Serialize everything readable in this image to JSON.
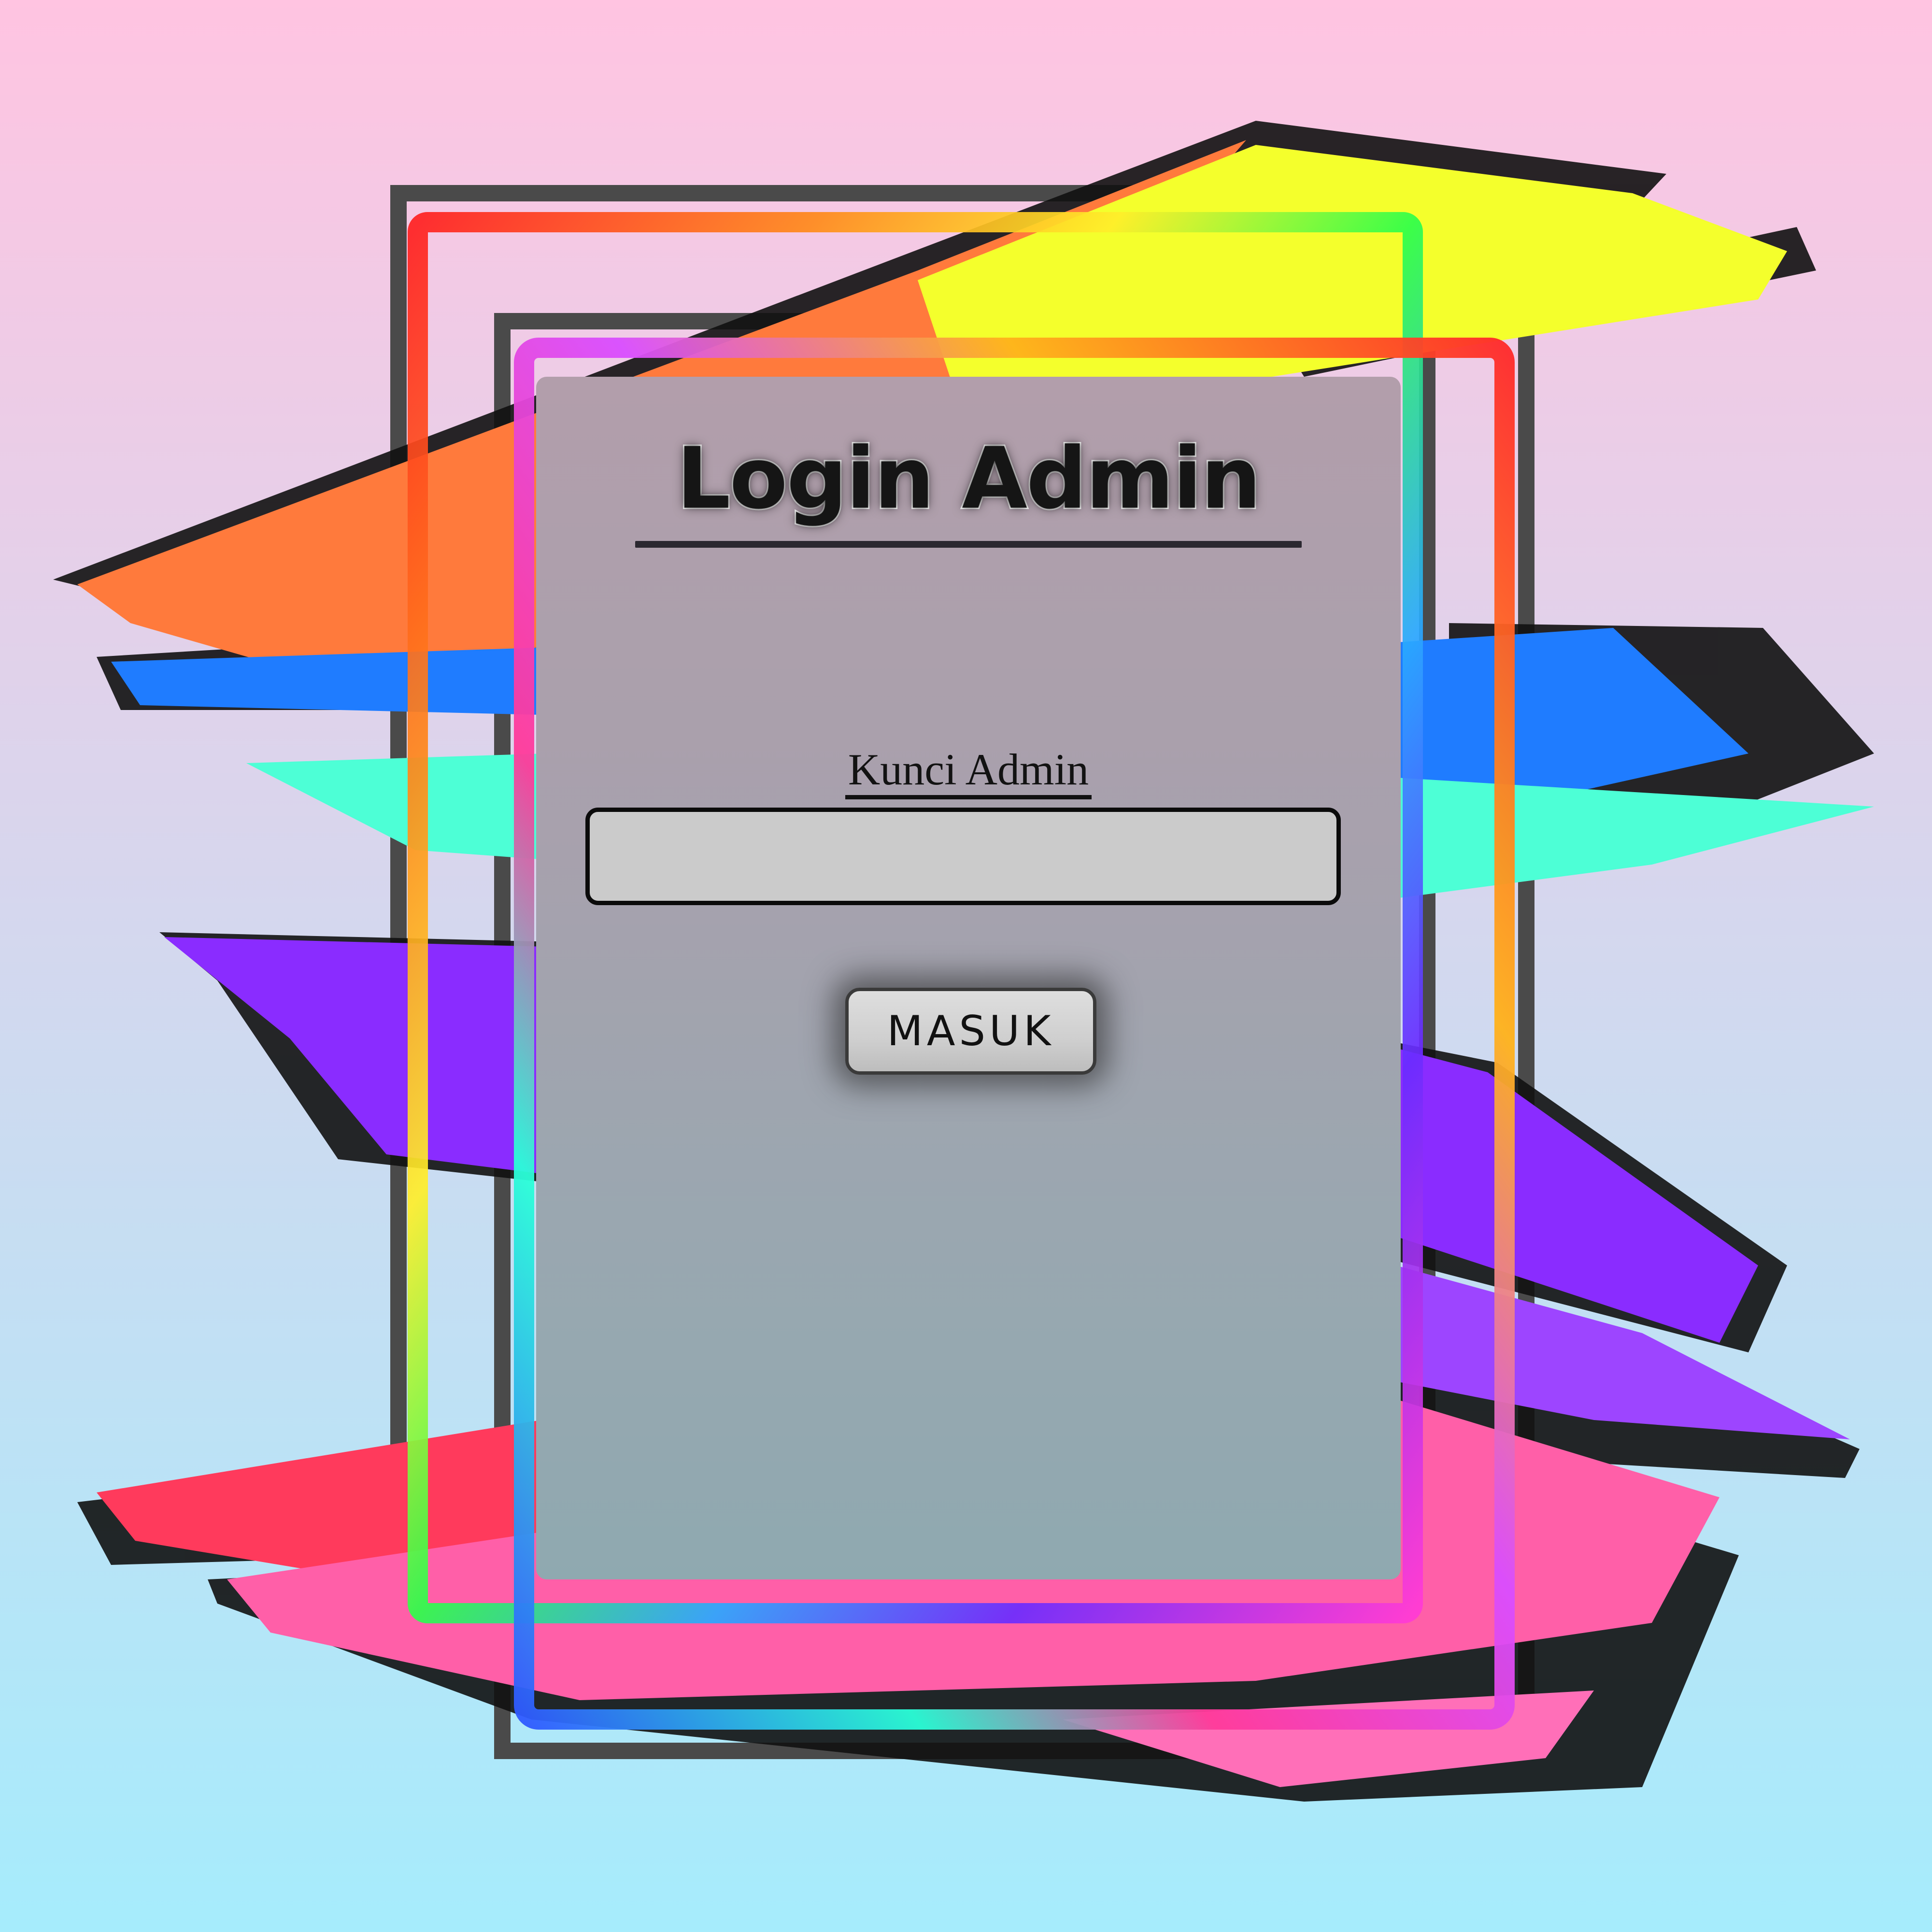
{
  "login": {
    "title": "Login Admin",
    "field_label": "Kunci Admin",
    "field_value": "",
    "submit_label": "MASUK"
  },
  "colors": {
    "bg_top": "#ffc4e1",
    "bg_bottom": "#a6ecfc",
    "panel": "#a7a1ad",
    "input_fill": "#cbcbcb",
    "stroke_orange": "#ff7a3c",
    "stroke_yellow": "#f4ff2c",
    "stroke_blue": "#1f7cff",
    "stroke_teal": "#4dffd6",
    "stroke_purple": "#8a2cff",
    "stroke_pink": "#ff5fa8",
    "stroke_red": "#ff3a5c"
  }
}
